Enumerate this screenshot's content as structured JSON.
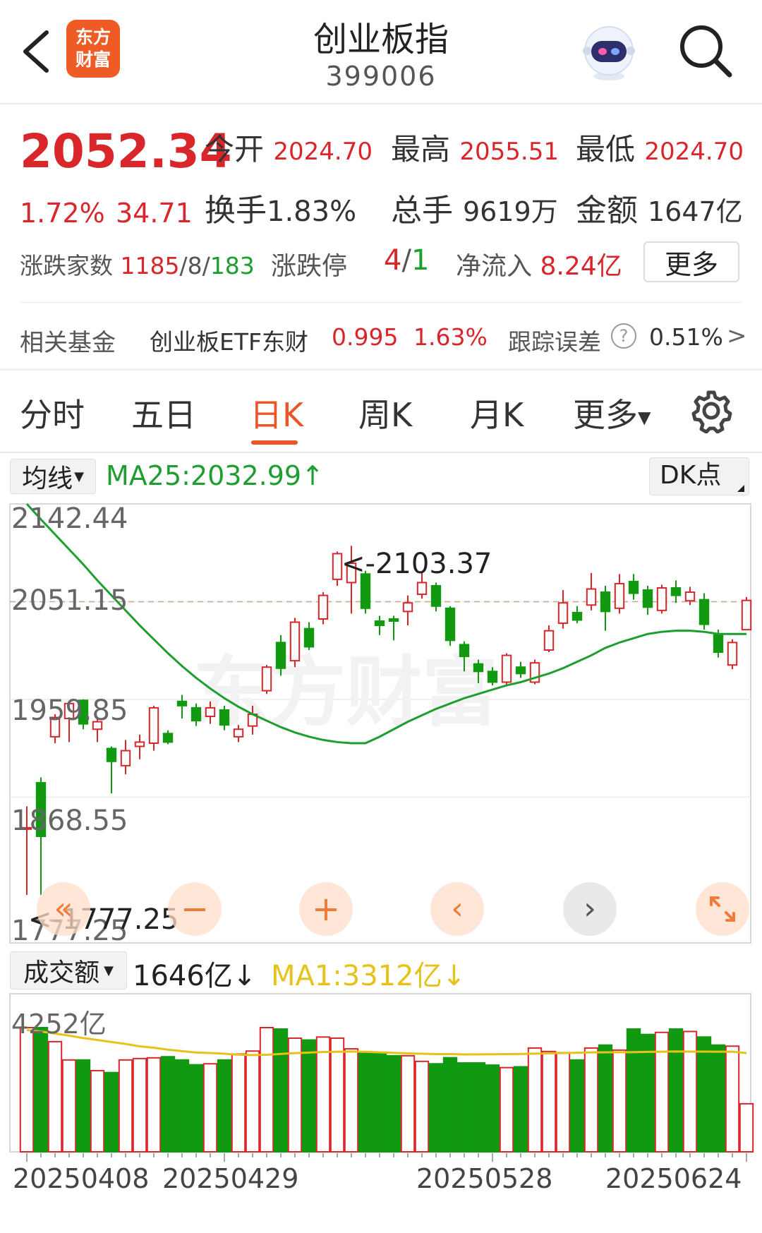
{
  "header": {
    "title": "创业板指",
    "code": "399006",
    "logo_top": "东方",
    "logo_bottom": "财富"
  },
  "quote": {
    "price": "2052.34",
    "change_pct": "1.72%",
    "change": "34.71",
    "open_label": "今开",
    "open": "2024.70",
    "high_label": "最高",
    "high": "2055.51",
    "low_label": "最低",
    "low": "2024.70",
    "turnover_label": "换手",
    "turnover": "1.83%",
    "volume_label": "总手",
    "volume": "9619万",
    "amount_label": "金额",
    "amount": "1647亿",
    "breadth_label": "涨跌家数",
    "breadth_up": "1185",
    "breadth_sep1": "/",
    "breadth_flat": "8",
    "breadth_sep2": "/",
    "breadth_down": "183",
    "limit_label": "涨跌停",
    "limit_up": "4",
    "limit_sep": "/",
    "limit_down": "1",
    "inflow_label": "净流入",
    "inflow": "8.24亿",
    "more_button": "更多"
  },
  "fund": {
    "label": "相关基金",
    "name": "创业板ETF东财",
    "price": "0.995",
    "pct": "1.63%",
    "tracking_label": "跟踪误差",
    "help": "?",
    "tracking_value": "0.51%",
    "arrow": ">"
  },
  "tabs": [
    {
      "label": "分时"
    },
    {
      "label": "五日"
    },
    {
      "label": "日K",
      "active": true
    },
    {
      "label": "周K"
    },
    {
      "label": "月K"
    },
    {
      "label": "更多"
    }
  ],
  "indicator_bar": {
    "ma_selector": "均线",
    "ma_text": "MA25:2032.99",
    "ma_arrow": "↑",
    "dk_button": "DK点"
  },
  "volume_bar": {
    "selector": "成交额",
    "value": "1646亿",
    "value_arrow": "↓",
    "ma_text": "MA1:3312亿",
    "ma_arrow": "↓",
    "max_label": "4252亿"
  },
  "watermark": "东方财富",
  "colors": {
    "up": "#d9262b",
    "down": "#119a11",
    "ma": "#1e9e2e",
    "vol_ma": "#e6c21a",
    "accent": "#e8562a"
  },
  "chart_data": {
    "type": "candlestick",
    "y_ticks": [
      "2142.44",
      "2051.15",
      "1959.85",
      "1868.55",
      "1777.25"
    ],
    "ylim": [
      1777.25,
      2142.44
    ],
    "reference_line": 2051.15,
    "max_annotation": "<-2103.37",
    "min_annotation": "<-1777.25",
    "x_tick_labels": [
      "20250408",
      "20250429",
      "20250528",
      "20250624"
    ],
    "candles": [
      [
        1840,
        1840,
        1860,
        1777.25
      ],
      [
        1882,
        1832,
        1887,
        1777.25
      ],
      [
        1925,
        1943,
        1946,
        1919
      ],
      [
        1942,
        1956,
        1958,
        1920
      ],
      [
        1959,
        1937,
        1960,
        1932
      ],
      [
        1932,
        1939,
        1942,
        1920
      ],
      [
        1914,
        1902,
        1916,
        1872
      ],
      [
        1898,
        1912,
        1922,
        1890
      ],
      [
        1916,
        1920,
        1927,
        1904
      ],
      [
        1919,
        1952,
        1954,
        1912
      ],
      [
        1928,
        1920,
        1931,
        1918
      ],
      [
        1958,
        1954,
        1964,
        1942
      ],
      [
        1952,
        1940,
        1956,
        1935
      ],
      [
        1944,
        1952,
        1958,
        1937
      ],
      [
        1950,
        1936,
        1954,
        1931
      ],
      [
        1925,
        1932,
        1936,
        1920
      ],
      [
        1935,
        1946,
        1954,
        1927
      ],
      [
        1968,
        1990,
        1992,
        1965
      ],
      [
        2013,
        1989,
        2020,
        1982
      ],
      [
        1996,
        2032,
        2036,
        1990
      ],
      [
        2026,
        2009,
        2032,
        2006
      ],
      [
        2035,
        2057,
        2060,
        2030
      ],
      [
        2072,
        2096,
        2098,
        2066
      ],
      [
        2069,
        2087,
        2103.37,
        2040
      ],
      [
        2077,
        2045,
        2080,
        2040
      ],
      [
        2033,
        2029,
        2038,
        2020
      ],
      [
        2035,
        2033,
        2038,
        2015
      ],
      [
        2042,
        2050,
        2057,
        2029
      ],
      [
        2058,
        2069,
        2079,
        2054
      ],
      [
        2066,
        2047,
        2069,
        2042
      ],
      [
        2045,
        2015,
        2047,
        2010
      ],
      [
        2011,
        2000,
        2014,
        1986
      ],
      [
        1993,
        1986,
        1997,
        1975
      ],
      [
        1986,
        1976,
        1990,
        1973
      ],
      [
        1976,
        2001,
        2003,
        1972
      ],
      [
        1990,
        1984,
        1995,
        1980
      ],
      [
        1976,
        1994,
        1997,
        1974
      ],
      [
        2006,
        2024,
        2029,
        2004
      ],
      [
        2031,
        2050,
        2062,
        2026
      ],
      [
        2041,
        2034,
        2047,
        2031
      ],
      [
        2048,
        2063,
        2078,
        2043
      ],
      [
        2060,
        2042,
        2066,
        2024
      ],
      [
        2045,
        2068,
        2077,
        2040
      ],
      [
        2070,
        2059,
        2077,
        2053
      ],
      [
        2062,
        2046,
        2066,
        2039
      ],
      [
        2043,
        2064,
        2067,
        2040
      ],
      [
        2064,
        2057,
        2071,
        2050
      ],
      [
        2052,
        2060,
        2065,
        2048
      ],
      [
        2053,
        2030,
        2059,
        2025
      ],
      [
        2020,
        2004,
        2025,
        1999
      ],
      [
        1992,
        2013,
        2016,
        1988
      ],
      [
        2025,
        2052.34,
        2055.51,
        2024.7
      ]
    ],
    "ma25": [
      2142.44,
      2128,
      2114,
      2100,
      2086,
      2071,
      2057,
      2043,
      2029,
      2016,
      2003,
      1991,
      1980,
      1970,
      1961,
      1953,
      1946,
      1940,
      1934,
      1929,
      1925,
      1922,
      1920,
      1919,
      1919,
      1925,
      1932,
      1939,
      1945,
      1951,
      1956,
      1961,
      1965,
      1969,
      1973,
      1976,
      1980,
      1984,
      1989,
      1995,
      2001,
      2008,
      2013,
      2017,
      2021,
      2023,
      2024,
      2024,
      2023,
      2021,
      2021,
      2021
    ],
    "amounts": [
      4252,
      4252,
      3772,
      3145,
      3145,
      2780,
      2713,
      3145,
      3193,
      3218,
      3256,
      3145,
      2981,
      3014,
      3145,
      3347,
      3449,
      4252,
      4204,
      3891,
      3828,
      3930,
      3891,
      3525,
      3424,
      3376,
      3289,
      3289,
      3097,
      3014,
      3222,
      3043,
      3043,
      2969,
      2883,
      2911,
      3554,
      3434,
      3395,
      3145,
      3554,
      3655,
      3482,
      4204,
      4018,
      4089,
      4204,
      4120,
      3930,
      3655,
      3617,
      1646
    ],
    "amount_ma1": [
      4167,
      4119,
      4049,
      3977,
      3894,
      3830,
      3759,
      3693,
      3612,
      3564,
      3497,
      3447,
      3401,
      3382,
      3358,
      3324,
      3313,
      3323,
      3351,
      3380,
      3398,
      3418,
      3424,
      3434,
      3424,
      3407,
      3388,
      3370,
      3357,
      3346,
      3347,
      3333,
      3338,
      3339,
      3345,
      3349,
      3361,
      3369,
      3382,
      3391,
      3403,
      3407,
      3410,
      3411,
      3421,
      3428,
      3436,
      3430,
      3431,
      3427,
      3429,
      3382
    ]
  }
}
